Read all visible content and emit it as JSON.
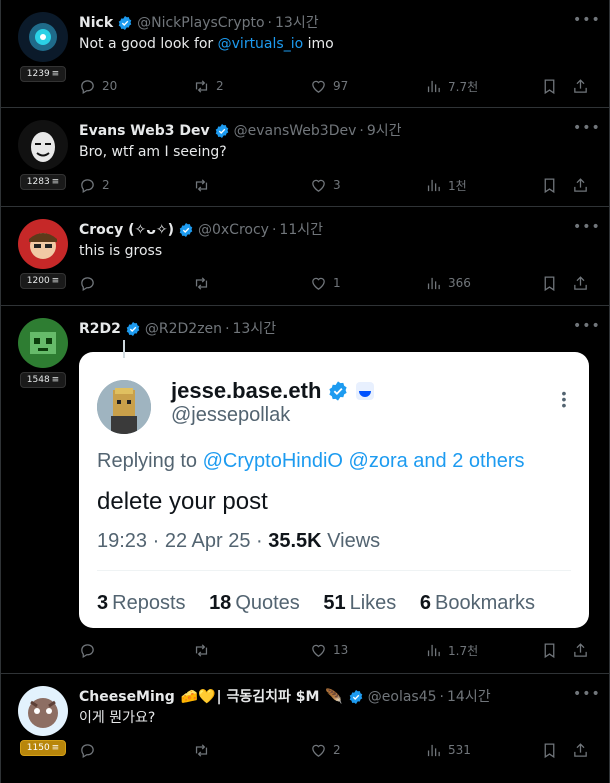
{
  "colors": {
    "background": "#000000",
    "text": "#e7e9ea",
    "muted": "#71767b",
    "link": "#1d9bf0",
    "verified": "#1d9bf0",
    "border": "#2f3336"
  },
  "tweets": [
    {
      "name": "Nick",
      "handle": "@NickPlaysCrypto",
      "time": "13시간",
      "score": "1239",
      "text_before": "Not a good look for ",
      "mention": "@virtuals_io",
      "text_after": " imo",
      "replies": "20",
      "reposts": "2",
      "likes": "97",
      "views": "7.7천"
    },
    {
      "name": "Evans Web3 Dev",
      "handle": "@evansWeb3Dev",
      "time": "9시간",
      "score": "1283",
      "text": "Bro, wtf am I seeing?",
      "replies": "2",
      "reposts": "",
      "likes": "3",
      "views": "1천"
    },
    {
      "name": "Crocy (✧ᴗ✧)",
      "handle": "@0xCrocy",
      "time": "11시간",
      "score": "1200",
      "text": "this is gross",
      "replies": "",
      "reposts": "",
      "likes": "1",
      "views": "366"
    },
    {
      "name": "R2D2",
      "handle": "@R2D2zen",
      "time": "13시간",
      "score": "1548",
      "replies": "",
      "reposts": "",
      "likes": "13",
      "views": "1.7천",
      "quoted": {
        "name": "jesse.base.eth",
        "handle": "@jessepollak",
        "replying_label": "Replying to ",
        "replying_mentions": "@CryptoHindiO @zora and 2 others",
        "body": "delete your post",
        "time": "19:23 · 22 Apr 25 · ",
        "views_count": "35.5K",
        "views_label": " Views",
        "reposts_count": "3",
        "reposts_label": "Reposts",
        "quotes_count": "18",
        "quotes_label": "Quotes",
        "likes_count": "51",
        "likes_label": "Likes",
        "bookmarks_count": "6",
        "bookmarks_label": "Bookmarks"
      }
    },
    {
      "name_part1": "CheeseMing ",
      "name_emoji": "🧀💛",
      "name_part2": "| 극동김치파 $M ",
      "name_emoji2": "🪶",
      "handle": "@eolas45",
      "time": "14시간",
      "score": "1150",
      "text": "이게 뭔가요?",
      "replies": "",
      "reposts": "",
      "likes": "2",
      "views": "531"
    }
  ],
  "icons": {
    "reply": "reply-icon",
    "repost": "repost-icon",
    "like": "heart-icon",
    "views": "views-icon",
    "bookmark": "bookmark-icon",
    "share": "share-icon",
    "more": "more-icon",
    "verified": "verified-icon"
  },
  "score_symbol": "≡"
}
